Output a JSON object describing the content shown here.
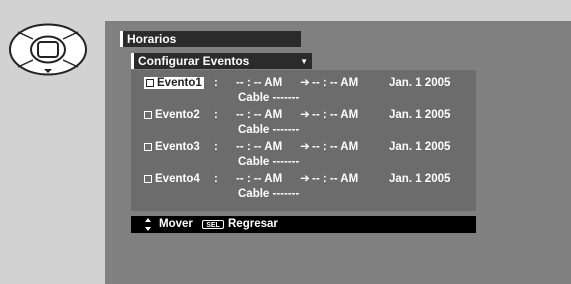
{
  "header": {
    "title": "Horarios"
  },
  "menu": {
    "selected": "Configurar Eventos"
  },
  "events": [
    {
      "name": "Evento1",
      "colon": ":",
      "start": "-- : -- AM",
      "end": "-- : -- AM",
      "date": "Jan. 1 2005",
      "channel": "Cable  -------",
      "selected": true
    },
    {
      "name": "Evento2",
      "colon": ":",
      "start": "-- : -- AM",
      "end": "-- : -- AM",
      "date": "Jan. 1 2005",
      "channel": "Cable  -------",
      "selected": false
    },
    {
      "name": "Evento3",
      "colon": ":",
      "start": "-- : -- AM",
      "end": "-- : -- AM",
      "date": "Jan. 1 2005",
      "channel": "Cable  -------",
      "selected": false
    },
    {
      "name": "Evento4",
      "colon": ":",
      "start": "-- : -- AM",
      "end": "-- : -- AM",
      "date": "Jan. 1 2005",
      "channel": "Cable  -------",
      "selected": false
    }
  ],
  "footer": {
    "move_label": "Mover",
    "sel_label": "SEL",
    "back_label": "Regresar"
  },
  "colors": {
    "screen": "#808080",
    "panel": "#6c6c6c",
    "bar": "#2b2b2b"
  },
  "icons": {
    "remote": "dpad-icon",
    "arrow": "right-arrow-icon",
    "updown": "up-down-arrow-icon"
  }
}
